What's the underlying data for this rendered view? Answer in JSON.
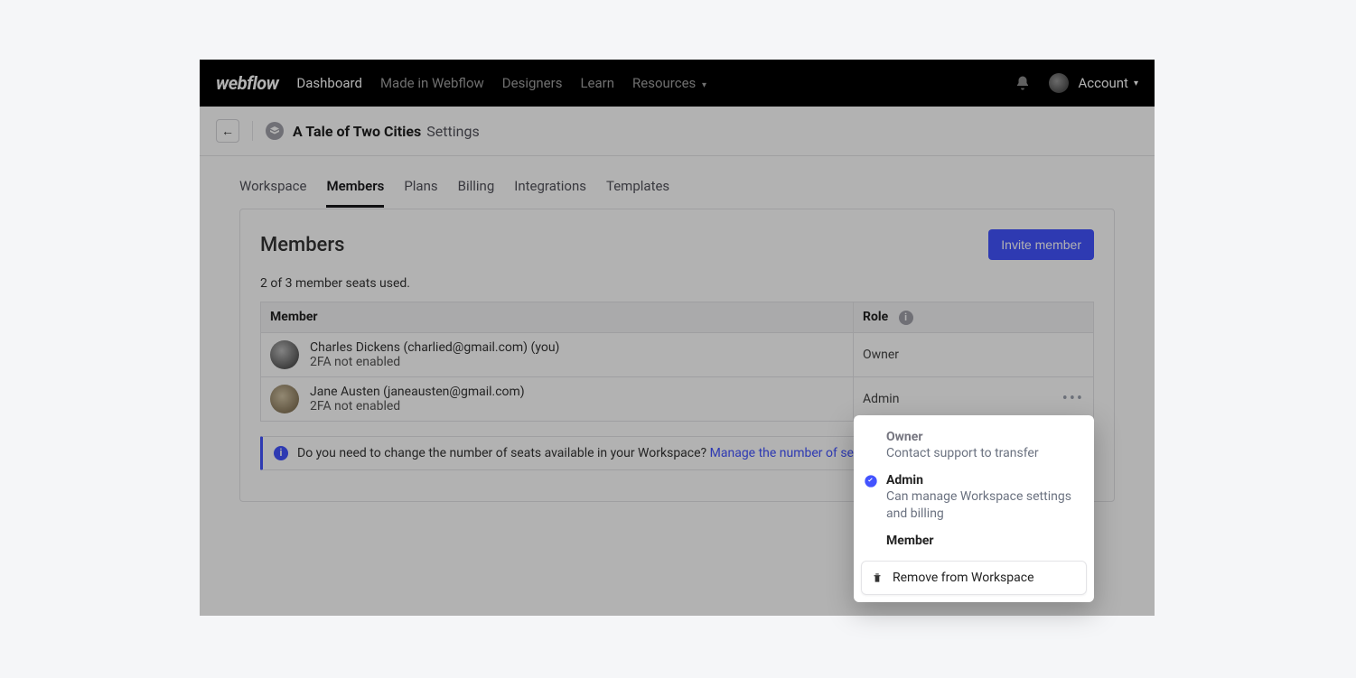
{
  "nav": {
    "logo": "webflow",
    "items": [
      "Dashboard",
      "Made in Webflow",
      "Designers",
      "Learn",
      "Resources"
    ],
    "account_label": "Account"
  },
  "subheader": {
    "workspace_name": "A Tale of Two Cities",
    "settings_label": "Settings"
  },
  "tabs": [
    "Workspace",
    "Members",
    "Plans",
    "Billing",
    "Integrations",
    "Templates"
  ],
  "members": {
    "title": "Members",
    "invite_label": "Invite member",
    "seats_text": "2 of 3 member seats used.",
    "columns": {
      "member": "Member",
      "role": "Role"
    },
    "rows": [
      {
        "name_line": "Charles Dickens (charlied@gmail.com) (you)",
        "tfa_line": "2FA not enabled",
        "role": "Owner",
        "has_menu": false
      },
      {
        "name_line": "Jane Austen (janeausten@gmail.com)",
        "tfa_line": "2FA not enabled",
        "role": "Admin",
        "has_menu": true
      }
    ],
    "alert_text": "Do you need to change the number of seats available in your Workspace? ",
    "alert_link": "Manage the number of seats in your Workspace."
  },
  "popover": {
    "owner": {
      "title": "Owner",
      "desc": "Contact support to transfer"
    },
    "admin": {
      "title": "Admin",
      "desc": "Can manage Workspace settings and billing"
    },
    "member": {
      "title": "Member"
    },
    "remove": "Remove from Workspace"
  }
}
